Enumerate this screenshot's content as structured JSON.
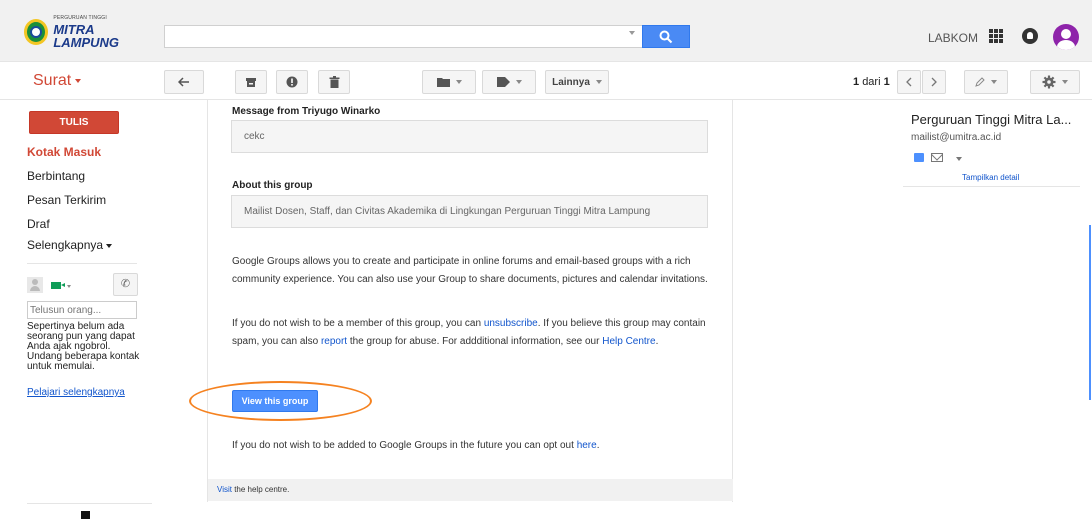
{
  "header": {
    "logo_small": "PERGURUAN TINGGI",
    "logo_big": "MITRA LAMPUNG",
    "search_value": "",
    "user_name": "LABKOM"
  },
  "toolbar": {
    "mail_label": "Surat",
    "more_label": "Lainnya",
    "pager_range": "1",
    "pager_of": "dari",
    "pager_total": "1"
  },
  "sidebar": {
    "compose_label": "TULIS",
    "items": [
      {
        "label": "Kotak Masuk"
      },
      {
        "label": "Berbintang"
      },
      {
        "label": "Pesan Terkirim"
      },
      {
        "label": "Draf"
      },
      {
        "label": "Selengkapnya"
      }
    ],
    "chat": {
      "search_placeholder": "Telusun orang...",
      "empty_text": "Sepertinya belum ada seorang pun yang dapat Anda ajak ngobrol. Undang beberapa kontak untuk memulai.",
      "learn_more": "Pelajari selengkapnya"
    }
  },
  "email": {
    "message_heading": "Message from Triyugo Winarko",
    "message_body": "cekc",
    "about_heading": "About this group",
    "about_body": "Mailist Dosen, Staff, dan Civitas Akademika di Lingkungan Perguruan Tinggi Mitra Lampung",
    "groups_info": "Google Groups allows you to create and participate in online forums and email-based groups with a rich community experience. You can also use your Group to share documents, pictures and calendar invitations.",
    "unsub_1": "If you do not wish to be a member of this group, you can ",
    "unsub_link": "unsubscribe",
    "unsub_2": ". If you believe this group may contain spam, you can also ",
    "report_link": "report",
    "unsub_3": " the group for abuse. For addditional information, see our ",
    "help_link": "Help Centre",
    "unsub_4": ".",
    "view_button": "View this group",
    "optout_1": "If you do not wish to be added to Google Groups in the future you can opt out ",
    "optout_link": "here",
    "optout_2": ".",
    "footer_link": "Visit",
    "footer_text": " the help centre."
  },
  "right_panel": {
    "sender_name": "Perguruan Tinggi Mitra La...",
    "sender_email": "mailist@umitra.ac.id",
    "details_link": "Tampilkan detail"
  },
  "colors": {
    "accent_red": "#d14836",
    "primary_blue": "#4d90fe",
    "highlight_orange": "#f58220",
    "avatar_purple": "#8e24aa"
  }
}
